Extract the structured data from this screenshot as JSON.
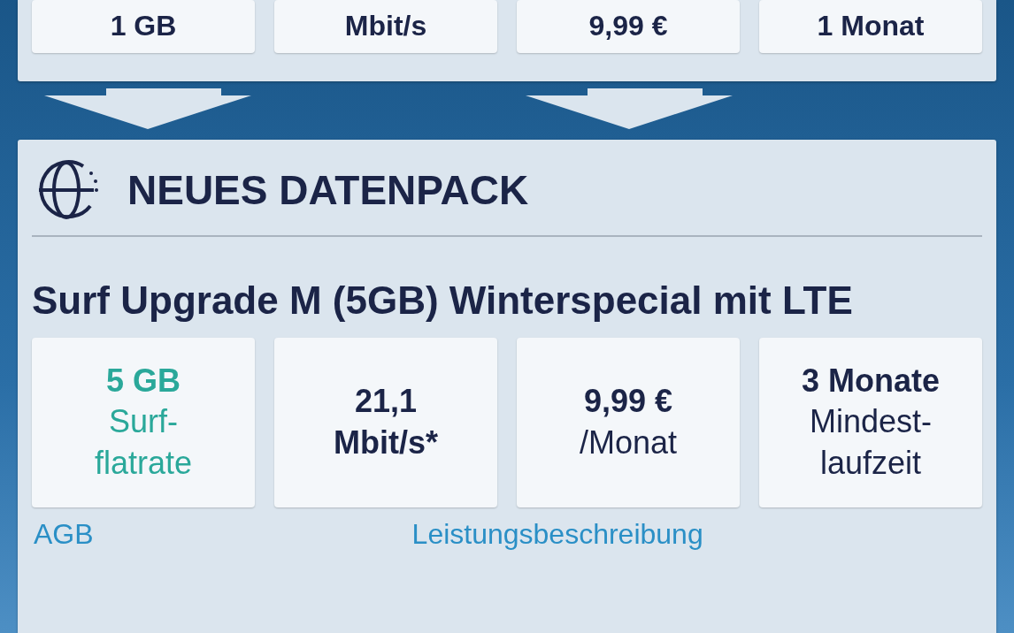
{
  "current_pack": {
    "cards": [
      {
        "color": "#1b2447",
        "lines": [
          {
            "text": "1 GB",
            "bold": true
          }
        ]
      },
      {
        "color": "#1b2447",
        "lines": [
          {
            "text": "Mbit/s",
            "bold": true
          }
        ]
      },
      {
        "color": "#1b2447",
        "lines": [
          {
            "text": "9,99 €",
            "bold": true
          }
        ]
      },
      {
        "color": "#1b2447",
        "lines": [
          {
            "text": "1 Monat",
            "bold": true
          }
        ]
      }
    ]
  },
  "new_pack": {
    "heading": "NEUES DATENPACK",
    "title": "Surf Upgrade M (5GB) Winterspecial mit LTE",
    "cards": [
      {
        "color": "#2aa89a",
        "lines": [
          {
            "text": "5 GB",
            "bold": true
          },
          {
            "text": "Surf-",
            "bold": false
          },
          {
            "text": "flatrate",
            "bold": false
          }
        ]
      },
      {
        "color": "#1b2447",
        "lines": [
          {
            "text": "21,1",
            "bold": true
          },
          {
            "text": "Mbit/s*",
            "bold": true
          }
        ]
      },
      {
        "color": "#1b2447",
        "lines": [
          {
            "text": "9,99 €",
            "bold": true
          },
          {
            "text": "/Monat",
            "bold": false
          }
        ]
      },
      {
        "color": "#1b2447",
        "lines": [
          {
            "text": "3 Monate",
            "bold": true
          },
          {
            "text": "Mindest-",
            "bold": false
          },
          {
            "text": "laufzeit",
            "bold": false
          }
        ]
      }
    ],
    "links": [
      "AGB",
      "Leistungsbeschreibung"
    ]
  }
}
